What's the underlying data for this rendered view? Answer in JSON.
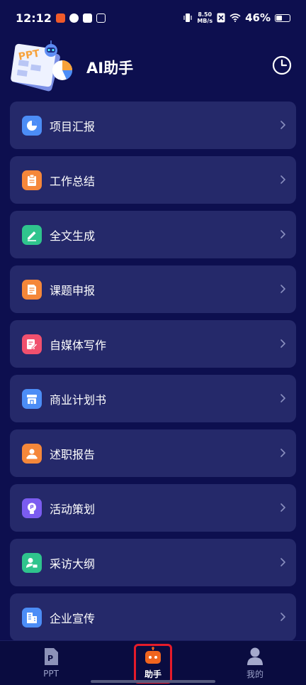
{
  "status_bar": {
    "time": "12:12",
    "net_speed_value": "8.50",
    "net_speed_unit": "MB/s",
    "battery_percent": "46%",
    "battery_level": 0.46
  },
  "header": {
    "title": "AI助手",
    "logo_text": "PPT",
    "history_icon": "clock-icon"
  },
  "menu": {
    "items": [
      {
        "label": "项目汇报",
        "icon": "pie-chart-icon",
        "color": "#4c8df6"
      },
      {
        "label": "工作总结",
        "icon": "clipboard-icon",
        "color": "#f5873a"
      },
      {
        "label": "全文生成",
        "icon": "pencil-icon",
        "color": "#2fc48d"
      },
      {
        "label": "课题申报",
        "icon": "document-icon",
        "color": "#f5873a"
      },
      {
        "label": "自媒体写作",
        "icon": "edit-note-icon",
        "color": "#f0506e"
      },
      {
        "label": "商业计划书",
        "icon": "store-icon",
        "color": "#4c8df6"
      },
      {
        "label": "述职报告",
        "icon": "person-icon",
        "color": "#f5873a"
      },
      {
        "label": "活动策划",
        "icon": "lightbulb-icon",
        "color": "#7b5cf0"
      },
      {
        "label": "采访大纲",
        "icon": "interview-icon",
        "color": "#2fc48d"
      },
      {
        "label": "企业宣传",
        "icon": "building-icon",
        "color": "#4c8df6"
      }
    ]
  },
  "tab_bar": {
    "tabs": [
      {
        "label": "PPT",
        "icon": "ppt-file-icon"
      },
      {
        "label": "助手",
        "icon": "robot-icon",
        "active": true
      },
      {
        "label": "我的",
        "icon": "profile-icon"
      }
    ]
  },
  "colors": {
    "background": "#0d0f4f",
    "card": "#25296a",
    "active_tab": "#f0641e",
    "highlight": "#e51b2a"
  }
}
